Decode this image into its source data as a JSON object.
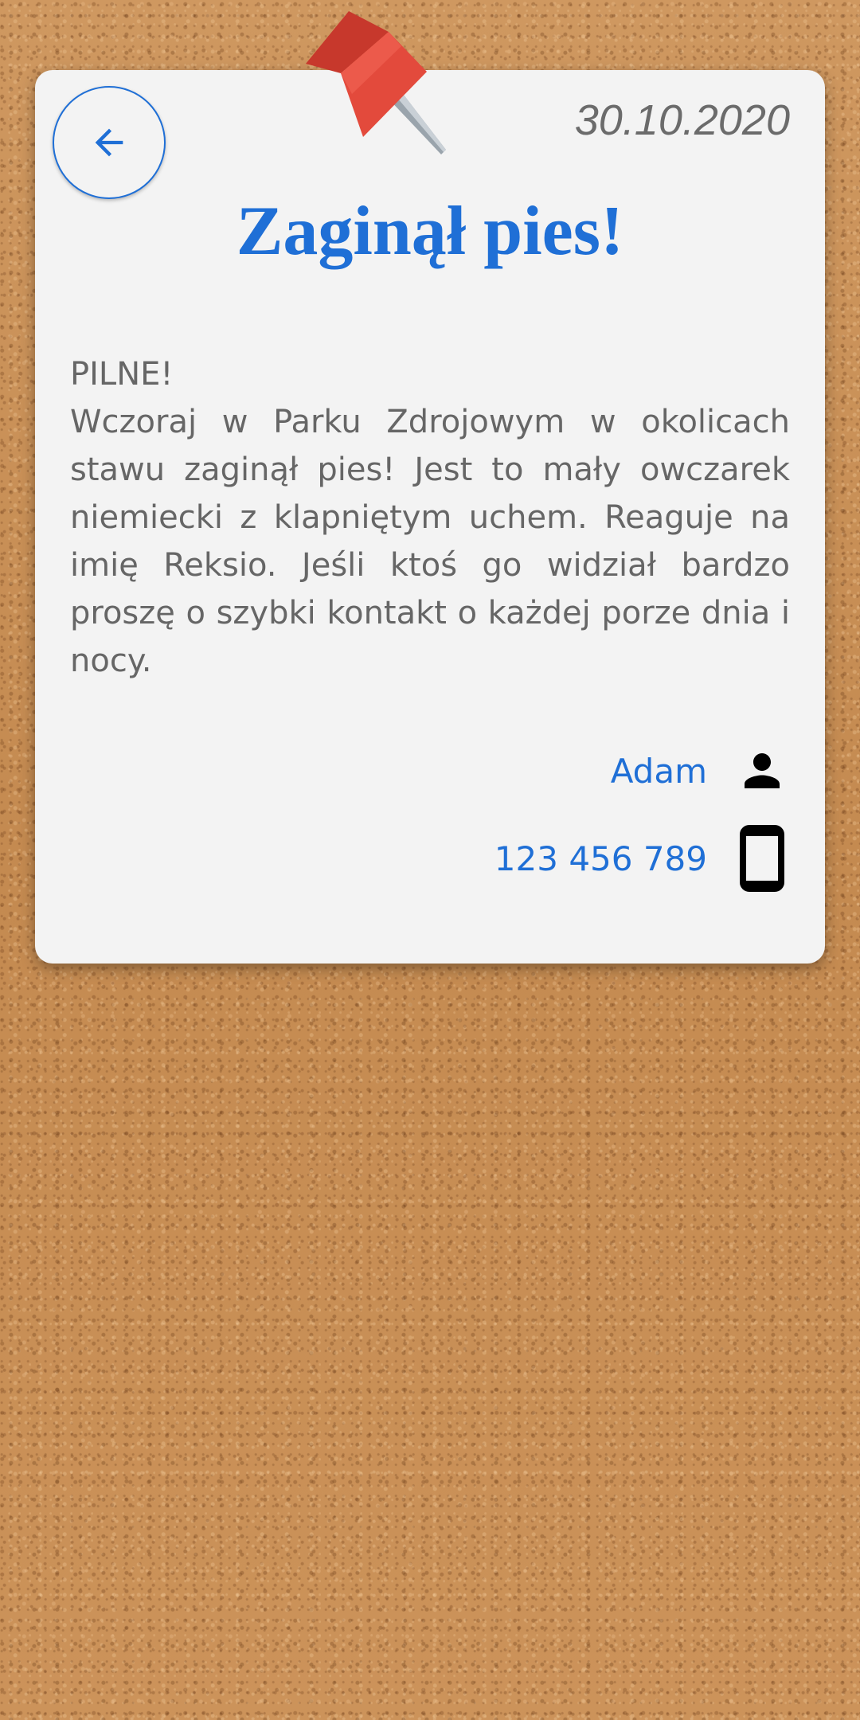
{
  "header": {
    "date": "30.10.2020",
    "back_icon": "arrow-left-icon"
  },
  "post": {
    "title": "Zaginął pies!",
    "urgent_label": "PILNE!",
    "body": "Wczoraj w Parku Zdrojowym w okolicach stawu zaginął pies! Jest to mały owczarek niemiecki z klapniętym uchem. Reaguje na imię Reksio. Jeśli ktoś go widział bardzo proszę o szybki kontakt o każdej porze dnia i nocy."
  },
  "contact": {
    "name": "Adam",
    "name_icon": "person-icon",
    "phone": "123 456 789",
    "phone_icon": "smartphone-icon"
  },
  "colors": {
    "accent": "#1f6fd6",
    "card_background": "#f3f3f3",
    "text": "#666666",
    "pin": "#e34a3c"
  }
}
